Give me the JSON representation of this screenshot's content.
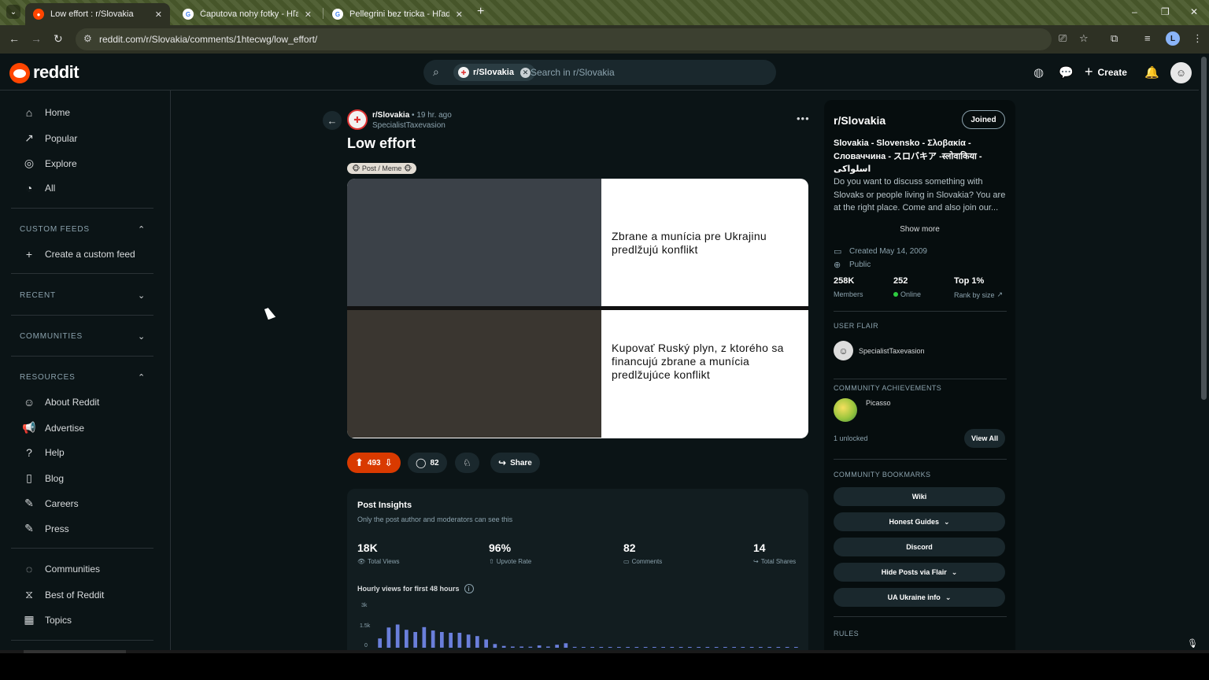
{
  "browser": {
    "tabs": [
      {
        "title": "Low effort : r/Slovakia",
        "close": "✕"
      },
      {
        "title": "Čaputova nohy fotky - Hľadať G",
        "close": "✕"
      },
      {
        "title": "Pellegrini bez tricka - Hľadať G",
        "close": "✕"
      }
    ],
    "new_tab": "+",
    "window": {
      "minimize": "–",
      "restore": "❐",
      "close": "✕"
    },
    "nav": {
      "back": "←",
      "forward": "→",
      "reload": "↻"
    },
    "url": "reddit.com/r/Slovakia/comments/1htecwg/low_effort/",
    "profile_initial": "L"
  },
  "header": {
    "logo_text": "reddit",
    "search": {
      "chip_label": "r/Slovakia",
      "placeholder": "Search in r/Slovakia"
    },
    "create_label": "Create"
  },
  "sidebar": {
    "nav": [
      {
        "label": "Home",
        "icon": "⌂"
      },
      {
        "label": "Popular",
        "icon": "↗"
      },
      {
        "label": "Explore",
        "icon": "◎"
      },
      {
        "label": "All",
        "icon": "◔"
      }
    ],
    "custom_feeds": {
      "heading": "CUSTOM FEEDS",
      "create_label": "Create a custom feed"
    },
    "recent_heading": "RECENT",
    "communities_heading": "COMMUNITIES",
    "resources": {
      "heading": "RESOURCES",
      "items": [
        {
          "label": "About Reddit",
          "icon": "☺"
        },
        {
          "label": "Advertise",
          "icon": "📢"
        },
        {
          "label": "Help",
          "icon": "?"
        },
        {
          "label": "Blog",
          "icon": "▯"
        },
        {
          "label": "Careers",
          "icon": "✎"
        },
        {
          "label": "Press",
          "icon": "✎"
        }
      ]
    },
    "bottom": [
      {
        "label": "Communities",
        "icon": "◌"
      },
      {
        "label": "Best of Reddit",
        "icon": "⧖"
      },
      {
        "label": "Topics",
        "icon": "▦"
      }
    ]
  },
  "post": {
    "subreddit": "r/Slovakia",
    "time": "• 19 hr. ago",
    "author": "SpecialistTaxevasion",
    "title": "Low effort",
    "flair": "🐵 Post / Meme 🐵",
    "meme": {
      "top_caption": "Zbrane a munícia pre Ukrajinu predlžujú konflikt",
      "bottom_caption": "Kupovať Ruský plyn, z ktorého sa financujú zbrane a munícia predlžujúce konflikt"
    },
    "actions": {
      "votes": "493",
      "comments": "82",
      "share": "Share"
    }
  },
  "insights": {
    "title": "Post Insights",
    "subtitle": "Only the post author and moderators can see this",
    "stats": [
      {
        "value": "18K",
        "label": "Total Views",
        "icon": "👁"
      },
      {
        "value": "96%",
        "label": "Upvote Rate",
        "icon": "⇧"
      },
      {
        "value": "82",
        "label": "Comments",
        "icon": "▭"
      },
      {
        "value": "14",
        "label": "Total Shares",
        "icon": "↪"
      }
    ],
    "chart_title": "Hourly views for first 48 hours",
    "info_icon": "i"
  },
  "chart_data": {
    "type": "bar",
    "title": "Hourly views for first 48 hours",
    "yticks": [
      "3k",
      "1.5k",
      "0"
    ],
    "ylim": [
      0,
      3000
    ],
    "values": [
      620,
      1350,
      1550,
      1200,
      1050,
      1380,
      1150,
      1050,
      1000,
      1000,
      880,
      780,
      550,
      250,
      120,
      80,
      80,
      70,
      150,
      80,
      200,
      300,
      60,
      40,
      40,
      40,
      40,
      40,
      40,
      40,
      40,
      40,
      40,
      40,
      40,
      40,
      40,
      40,
      40,
      40,
      40,
      40,
      40,
      40,
      40,
      40,
      40,
      40
    ],
    "bar_color": "#6a7fdb"
  },
  "community": {
    "name": "r/Slovakia",
    "joined_label": "Joined",
    "tagline": "Slovakia - Slovensko - Σλοβακία - Словаччина - スロバキア -स्लोवाकिया - اسلواکی",
    "description": "Do you want to discuss something with Slovaks or people living in Slovakia? You are at the right place. Come and also join our...",
    "show_more": "Show more",
    "created": "Created May 14, 2009",
    "visibility": "Public",
    "stats": [
      {
        "value": "258K",
        "label": "Members"
      },
      {
        "value": "252",
        "label": "Online"
      },
      {
        "value": "Top 1%",
        "label": "Rank by size"
      }
    ],
    "user_flair": {
      "heading": "USER FLAIR",
      "name": "SpecialistTaxevasion"
    },
    "achievements": {
      "heading": "COMMUNITY ACHIEVEMENTS",
      "name": "Picasso",
      "unlocked": "1 unlocked",
      "view_all": "View All"
    },
    "bookmarks": {
      "heading": "COMMUNITY BOOKMARKS",
      "items": [
        {
          "label": "Wiki",
          "chevron": ""
        },
        {
          "label": "Honest Guides",
          "chevron": "⌄"
        },
        {
          "label": "Discord",
          "chevron": ""
        },
        {
          "label": "Hide Posts via Flair",
          "chevron": "⌄"
        },
        {
          "label": "UA Ukraine info",
          "chevron": "⌄"
        }
      ]
    },
    "rules_heading": "RULES"
  }
}
